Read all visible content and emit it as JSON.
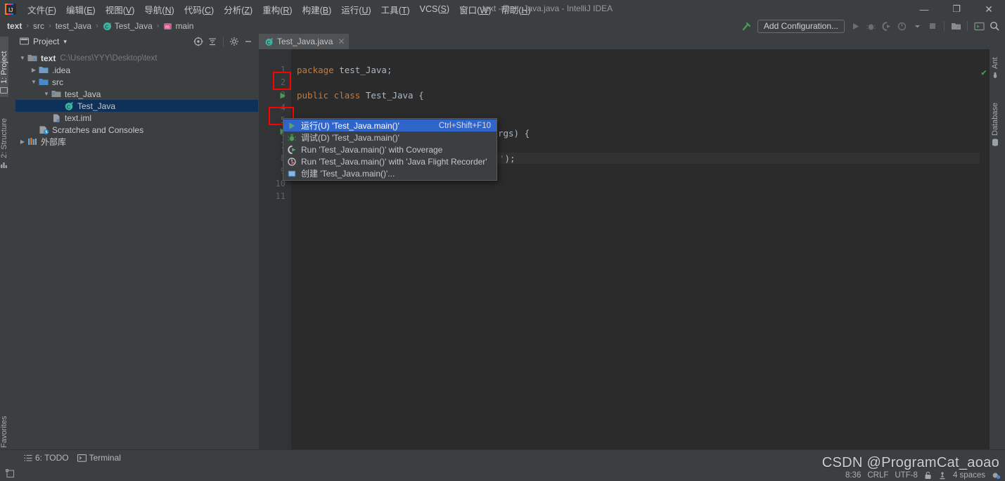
{
  "window": {
    "title": "text - Test_Java.java - IntelliJ IDEA",
    "minimize": "—",
    "maximize": "❐",
    "close": "✕"
  },
  "menubar": {
    "items": [
      {
        "label": "文件",
        "mnemonic": "F"
      },
      {
        "label": "编辑",
        "mnemonic": "E"
      },
      {
        "label": "视图",
        "mnemonic": "V"
      },
      {
        "label": "导航",
        "mnemonic": "N"
      },
      {
        "label": "代码",
        "mnemonic": "C"
      },
      {
        "label": "分析",
        "mnemonic": "Z"
      },
      {
        "label": "重构",
        "mnemonic": "R"
      },
      {
        "label": "构建",
        "mnemonic": "B"
      },
      {
        "label": "运行",
        "mnemonic": "U"
      },
      {
        "label": "工具",
        "mnemonic": "T"
      },
      {
        "label": "VCS",
        "mnemonic": "S"
      },
      {
        "label": "窗口",
        "mnemonic": "W"
      },
      {
        "label": "帮助",
        "mnemonic": "H"
      }
    ]
  },
  "navbar": {
    "crumbs": [
      {
        "label": "text",
        "icon": "none",
        "bold": true
      },
      {
        "label": "src",
        "icon": "none",
        "bold": false
      },
      {
        "label": "test_Java",
        "icon": "none",
        "bold": false
      },
      {
        "label": "Test_Java",
        "icon": "class-icon",
        "bold": false
      },
      {
        "label": "main",
        "icon": "method-icon",
        "bold": false
      }
    ],
    "separator": "›",
    "add_configuration": "Add Configuration...",
    "icons": [
      "build-hammer-icon",
      "run-icon",
      "debug-icon",
      "run-coverage-icon",
      "profile-icon",
      "dropdown-arrow-icon",
      "stop-icon",
      "project-structure-icon",
      "terminal-icon",
      "search-everywhere-icon"
    ]
  },
  "left_strip": {
    "tabs": [
      {
        "label": "1: Project",
        "icon": "project-icon",
        "selected": true
      },
      {
        "label": "2: Structure",
        "icon": "structure-icon",
        "selected": false
      },
      {
        "label": "2: Favorites",
        "icon": "favorites-star-icon",
        "selected": false
      }
    ]
  },
  "right_strip": {
    "tabs": [
      {
        "label": "Ant",
        "icon": "ant-icon"
      },
      {
        "label": "Database",
        "icon": "database-icon"
      }
    ]
  },
  "project_panel": {
    "title": "Project",
    "dropdown": "▾",
    "actions": [
      "locate-icon",
      "collapse-all-icon",
      "settings-gear-icon",
      "hide-icon"
    ],
    "tree": [
      {
        "label": "text",
        "path": "C:\\Users\\YYY\\Desktop\\text",
        "icon": "module-icon",
        "arrow": "down",
        "indent": 0,
        "bold": true,
        "selected": false
      },
      {
        "label": ".idea",
        "path": "",
        "icon": "folder-icon",
        "arrow": "right",
        "indent": 1,
        "bold": false,
        "selected": false
      },
      {
        "label": "src",
        "path": "",
        "icon": "source-folder-icon",
        "arrow": "down",
        "indent": 1,
        "bold": false,
        "selected": false
      },
      {
        "label": "test_Java",
        "path": "",
        "icon": "package-icon",
        "arrow": "down",
        "indent": 2,
        "bold": false,
        "selected": false
      },
      {
        "label": "Test_Java",
        "path": "",
        "icon": "class-icon",
        "arrow": "none",
        "indent": 3,
        "bold": false,
        "selected": true
      },
      {
        "label": "text.iml",
        "path": "",
        "icon": "iml-icon",
        "arrow": "none",
        "indent": 1,
        "bold": false,
        "selected": false
      },
      {
        "label": "Scratches and Consoles",
        "path": "",
        "icon": "scratches-icon",
        "arrow": "none",
        "indent": 0,
        "bold": false,
        "selected": false
      },
      {
        "label": "外部库",
        "path": "",
        "icon": "library-icon",
        "arrow": "right",
        "indent": 0,
        "bold": false,
        "selected": false
      }
    ]
  },
  "editor": {
    "tab": {
      "name": "Test_Java.java",
      "icon": "java-class-icon",
      "close": "✕"
    },
    "line_numbers": [
      "1",
      "2",
      "3",
      "4",
      "5",
      "6",
      "7",
      "8",
      "9",
      "10",
      "11"
    ],
    "lines": [
      {
        "n": 1,
        "segments": [
          {
            "t": "package",
            "c": "kw"
          },
          {
            "t": " test_Java;",
            "c": "id"
          }
        ]
      },
      {
        "n": 2,
        "segments": []
      },
      {
        "n": 3,
        "segments": [
          {
            "t": "public class",
            "c": "kw"
          },
          {
            "t": " Test_Java {",
            "c": "id"
          }
        ]
      },
      {
        "n": 4,
        "segments": []
      },
      {
        "n": 5,
        "segments": []
      },
      {
        "n": 6,
        "segments": [
          {
            "t": "    public static void ",
            "c": "kw"
          },
          {
            "t": "main(String[] args) {",
            "c": "id"
          }
        ]
      },
      {
        "n": 7,
        "segments": []
      },
      {
        "n": 8,
        "segments": [
          {
            "t": "');",
            "c": "id"
          }
        ]
      },
      {
        "n": 9,
        "segments": []
      },
      {
        "n": 10,
        "segments": []
      },
      {
        "n": 11,
        "segments": []
      }
    ],
    "gutter_run_markers": [
      {
        "line": 3
      },
      {
        "line": 6
      }
    ],
    "inspection_status": "✔"
  },
  "context_menu": {
    "items": [
      {
        "label": "运行(U) 'Test_Java.main()'",
        "mnemonic": "U",
        "shortcut": "Ctrl+Shift+F10",
        "icon": "run-green-play-icon",
        "selected": true
      },
      {
        "label": "调试(D) 'Test_Java.main()'",
        "mnemonic": "D",
        "shortcut": "",
        "icon": "debug-bug-icon",
        "selected": false
      },
      {
        "label": "Run 'Test_Java.main()' with Coverage",
        "mnemonic": "",
        "shortcut": "",
        "icon": "run-coverage-icon",
        "selected": false
      },
      {
        "label": "Run 'Test_Java.main()' with 'Java Flight Recorder'",
        "mnemonic": "",
        "shortcut": "",
        "icon": "flight-recorder-icon",
        "selected": false
      },
      {
        "label": "创建 'Test_Java.main()'...",
        "mnemonic": "",
        "shortcut": "",
        "icon": "create-config-icon",
        "selected": false
      }
    ]
  },
  "status_bar": {
    "left_buttons": [
      {
        "label": "6: TODO",
        "mnemonic": "6",
        "icon": "todo-list-icon"
      },
      {
        "label": "Terminal",
        "mnemonic": "",
        "icon": "terminal-icon"
      }
    ],
    "right_items": [
      {
        "label": "8:36",
        "name": "caret-position"
      },
      {
        "label": "CRLF",
        "name": "line-separator"
      },
      {
        "label": "UTF-8",
        "name": "file-encoding"
      },
      {
        "label": "",
        "name": "lock-icon"
      },
      {
        "label": "",
        "name": "git-branch-icon"
      },
      {
        "label": "4 spaces",
        "name": "indent-setting"
      },
      {
        "label": "",
        "name": "event-log-icon"
      }
    ]
  },
  "watermark": {
    "text": "CSDN @ProgramCat_aoao",
    "sub": ""
  },
  "colors": {
    "background": "#3c3f41",
    "editor_bg": "#2b2b2b",
    "selection_blue": "#2f65ca",
    "tree_selection": "#0d3158",
    "keyword_orange": "#cc7832",
    "identifier": "#a9b7c6",
    "green_run": "#499c54",
    "annotation_red": "#ff0000"
  }
}
